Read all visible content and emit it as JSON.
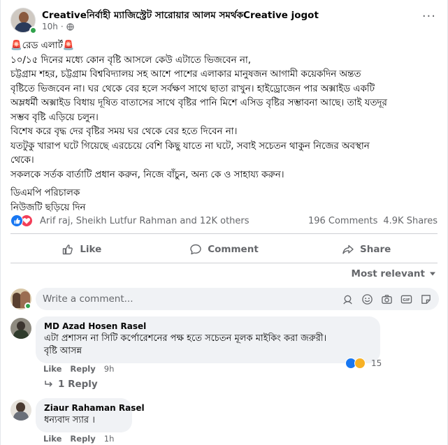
{
  "post": {
    "author": "Creativeনির্বাহী ম্যাজিস্ট্রেট সারোয়ার আলম সমর্থকCreative jogot",
    "time": "10h",
    "audience_icon": "globe-icon",
    "lines": [
      "🚨রেড এলার্ট🚨",
      " ১০/১৫ দিনের মধ্যে কোন বৃষ্টি আসলে কেউ এটাতে ভিজবেন না,",
      "চট্টগ্রাম শহর, চট্টগ্রাম বিশ্ববিদ্যালয় সহ আশে পাশের এলাকার মানুষজন আগামী কয়েকদিন অন্তত",
      "বৃষ্টিতে ভিজবেন না। ঘর থেকে বের হলে সর্বক্ষণ সাথে ছাতা রাখুন। হাইড্রোজেন পার অক্সাইড একটি",
      "অম্লধর্মী অক্সাইড বিধায় দূষিত বাতাসের সাথে বৃষ্টির পানি মিশে এসিড বৃষ্টির সম্ভাবনা আছে। তাই যতদূর",
      "সম্ভব বৃষ্টি এড়িয়ে চলুন।",
      "বিশেষ করে বৃদ্ধ দের বৃষ্টির সময় ঘর থেকে বের হতে দিবেন না।",
      "যতটুকু খারাপ ঘটে গিয়েছে এরচেয়ে বেশি কিছু যাতে না ঘটে, সবাই সচেতন থাকুন নিজের অবস্থান",
      "থেকে।",
      "সকলকে সর্তক বার্তাটি প্রধান করুন, নিজে বাঁচুন, অন্য কে ও সাহায্য করুন।",
      "",
      "ডিএমপি পরিচালক",
      "নিউজটি ছড়িয়ে দিন"
    ]
  },
  "reactions": {
    "names": "Arif raj, Sheikh Lutfur Rahman and 12K others",
    "comments": "196 Comments",
    "shares": "4.9K Shares"
  },
  "actions": {
    "like": "Like",
    "comment": "Comment",
    "share": "Share"
  },
  "sort_label": "Most relevant",
  "composer": {
    "placeholder": "Write a comment..."
  },
  "comments": [
    {
      "name": "MD Azad Hosen Rasel",
      "text_lines": [
        "এটা প্রশাসন না সিটি কর্পোরেশনের পক্ষ হতে সচেতন মূলক মাইকিং করা জরুরী।",
        "বৃষ্টি আসন্ন"
      ],
      "like": "Like",
      "reply": "Reply",
      "time": "9h",
      "reaction_count": "15",
      "replies_label": "1 Reply"
    },
    {
      "name": "Ziaur Rahaman Rasel",
      "text_lines": [
        "ধন্যবাদ স্যার ।"
      ],
      "like": "Like",
      "reply": "Reply",
      "time": "1h"
    }
  ],
  "colors": {
    "accent": "#1877f2",
    "love": "#f33e58",
    "online": "#31a24c",
    "muted": "#65676b",
    "bubble": "#f0f2f5"
  }
}
